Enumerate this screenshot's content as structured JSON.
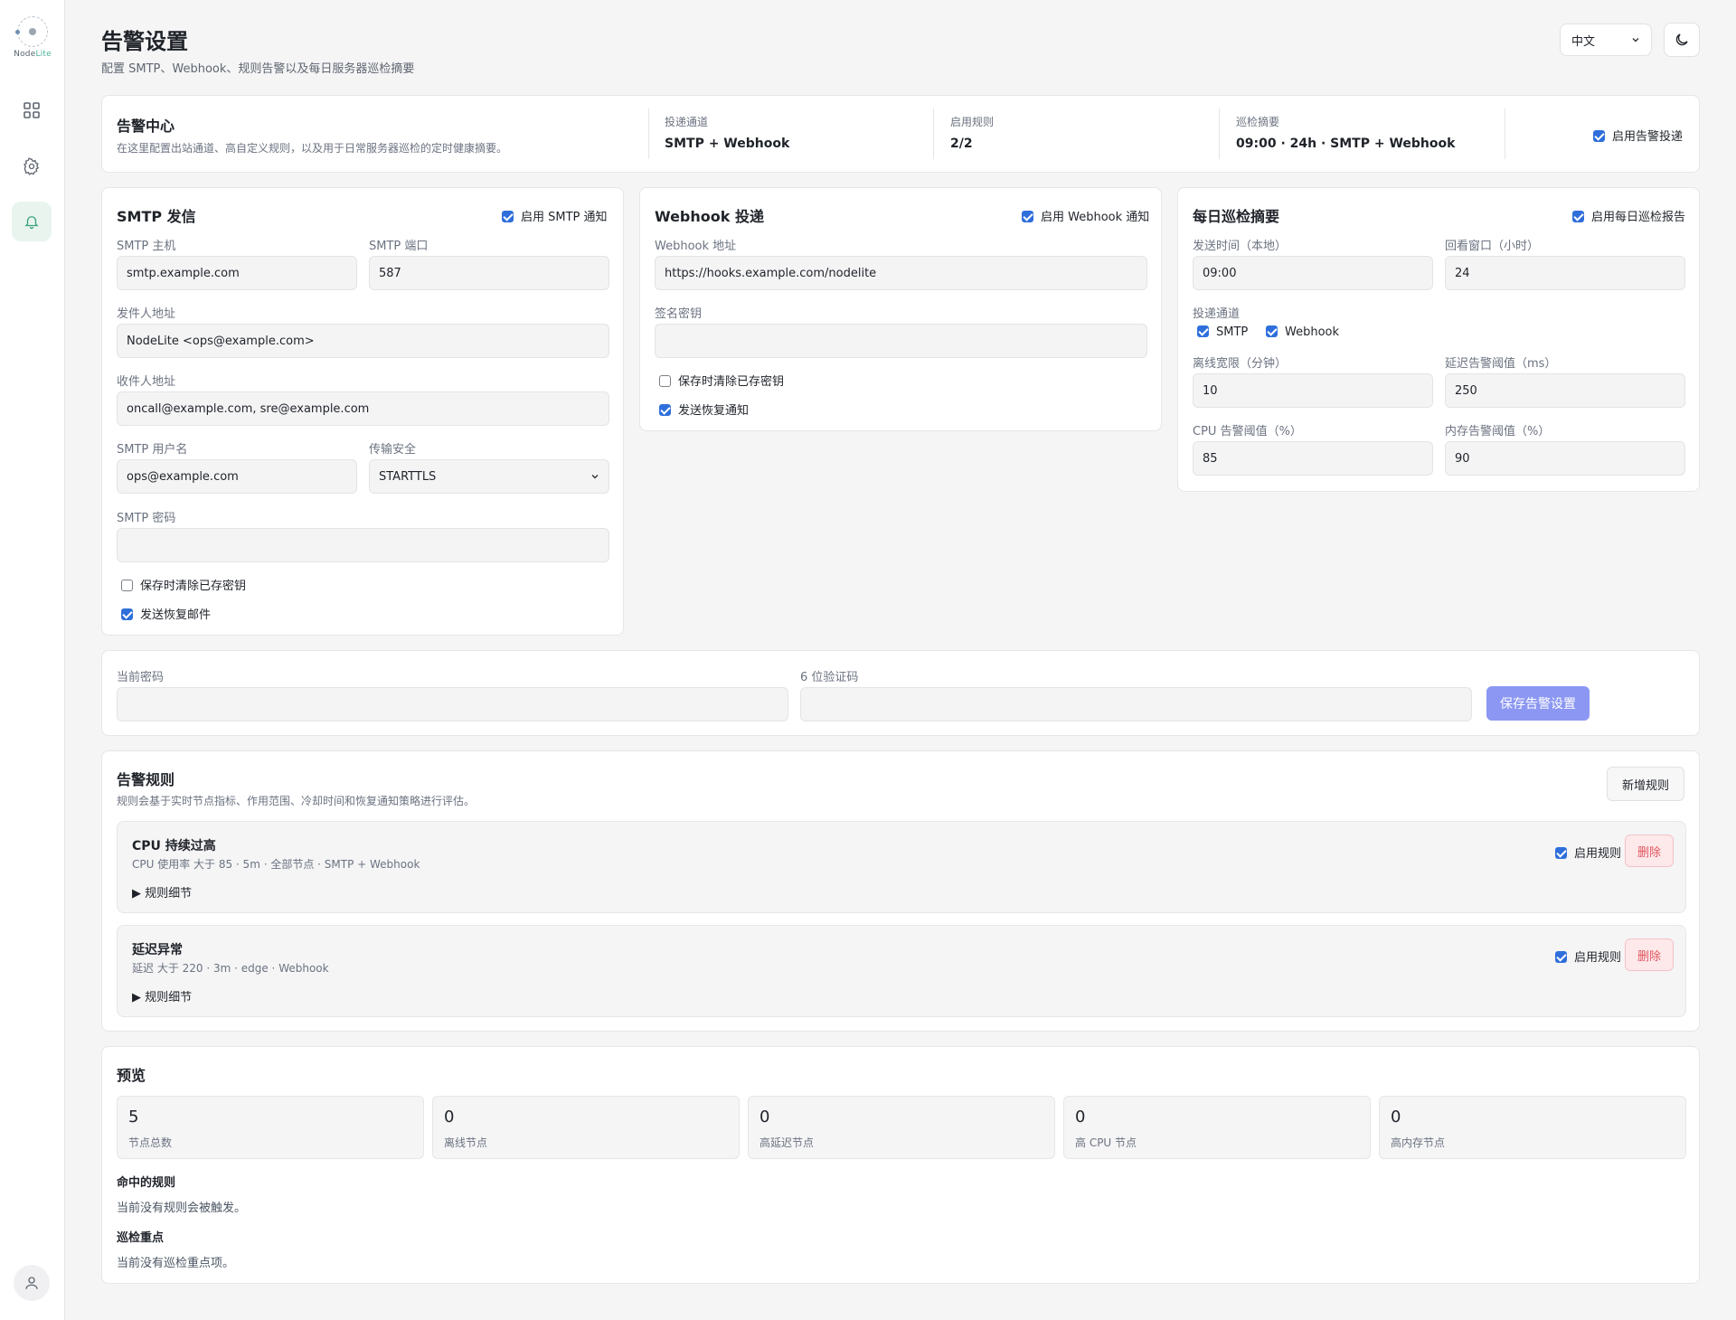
{
  "sidebar": {
    "logo_text_a": "Node",
    "logo_text_b": "Lite",
    "items": [
      {
        "name": "dashboard",
        "icon": "grid-icon"
      },
      {
        "name": "settings",
        "icon": "gear-icon"
      },
      {
        "name": "alerts",
        "icon": "bell-icon",
        "active": true
      }
    ],
    "user_icon": "user-icon"
  },
  "header": {
    "title": "告警设置",
    "subtitle": "配置 SMTP、Webhook、规则告警以及每日服务器巡检摘要",
    "language": "中文",
    "theme_icon": "moon-icon"
  },
  "summary": {
    "title": "告警中心",
    "desc": "在这里配置出站通道、高自定义规则，以及用于日常服务器巡检的定时健康摘要。",
    "channels_label": "投递通道",
    "channels_value": "SMTP + Webhook",
    "rules_label": "启用规则",
    "rules_value": "2/2",
    "inspection_label": "巡检摘要",
    "inspection_value": "09:00 · 24h · SMTP + Webhook",
    "enable_label": "启用告警投递",
    "enabled": true
  },
  "smtp": {
    "title": "SMTP 发信",
    "enable_label": "启用 SMTP 通知",
    "enabled": true,
    "host_label": "SMTP 主机",
    "host_value": "smtp.example.com",
    "port_label": "SMTP 端口",
    "port_value": "587",
    "from_label": "发件人地址",
    "from_value": "NodeLite <ops@example.com>",
    "to_label": "收件人地址",
    "to_value": "oncall@example.com, sre@example.com",
    "user_label": "SMTP 用户名",
    "user_value": "ops@example.com",
    "security_label": "传输安全",
    "security_value": "STARTTLS",
    "password_label": "SMTP 密码",
    "password_value": "",
    "clear_secret_label": "保存时清除已存密钥",
    "clear_secret": false,
    "recovery_label": "发送恢复邮件",
    "recovery": true
  },
  "webhook": {
    "title": "Webhook 投递",
    "enable_label": "启用 Webhook 通知",
    "enabled": true,
    "url_label": "Webhook 地址",
    "url_value": "https://hooks.example.com/nodelite",
    "secret_label": "签名密钥",
    "secret_value": "",
    "clear_secret_label": "保存时清除已存密钥",
    "clear_secret": false,
    "recovery_label": "发送恢复通知",
    "recovery": true
  },
  "daily": {
    "title": "每日巡检摘要",
    "enable_label": "启用每日巡检报告",
    "enabled": true,
    "time_label": "发送时间（本地）",
    "time_value": "09:00",
    "window_label": "回看窗口（小时）",
    "window_value": "24",
    "channels_label": "投递通道",
    "channel_smtp": "SMTP",
    "channel_webhook": "Webhook",
    "offline_label": "离线宽限（分钟）",
    "offline_value": "10",
    "latency_label": "延迟告警阈值（ms）",
    "latency_value": "250",
    "cpu_label": "CPU 告警阈值（%）",
    "cpu_value": "85",
    "mem_label": "内存告警阈值（%）",
    "mem_value": "90"
  },
  "auth": {
    "password_label": "当前密码",
    "code_label": "6 位验证码",
    "save_label": "保存告警设置"
  },
  "rules": {
    "title": "告警规则",
    "desc": "规则会基于实时节点指标、作用范围、冷却时间和恢复通知策略进行评估。",
    "add_label": "新增规则",
    "items": [
      {
        "name": "CPU 持续过高",
        "meta": "CPU 使用率 大于 85 · 5m · 全部节点 · SMTP + Webhook",
        "details": "▶ 规则细节",
        "enable_label": "启用规则",
        "delete_label": "删除"
      },
      {
        "name": "延迟异常",
        "meta": "延迟 大于 220 · 3m · edge · Webhook",
        "details": "▶ 规则细节",
        "enable_label": "启用规则",
        "delete_label": "删除"
      }
    ]
  },
  "preview": {
    "title": "预览",
    "stats": [
      {
        "value": "5",
        "label": "节点总数"
      },
      {
        "value": "0",
        "label": "离线节点"
      },
      {
        "value": "0",
        "label": "高延迟节点"
      },
      {
        "value": "0",
        "label": "高 CPU 节点"
      },
      {
        "value": "0",
        "label": "高内存节点"
      }
    ],
    "matched_title": "命中的规则",
    "matched_text": "当前没有规则会被触发。",
    "focus_title": "巡检重点",
    "focus_text": "当前没有巡检重点项。"
  },
  "colors": {
    "accent": "#2f6fdb",
    "primary_button": "#8b97f2",
    "danger": "#e0565f",
    "active_nav": "#e9f4ee"
  }
}
